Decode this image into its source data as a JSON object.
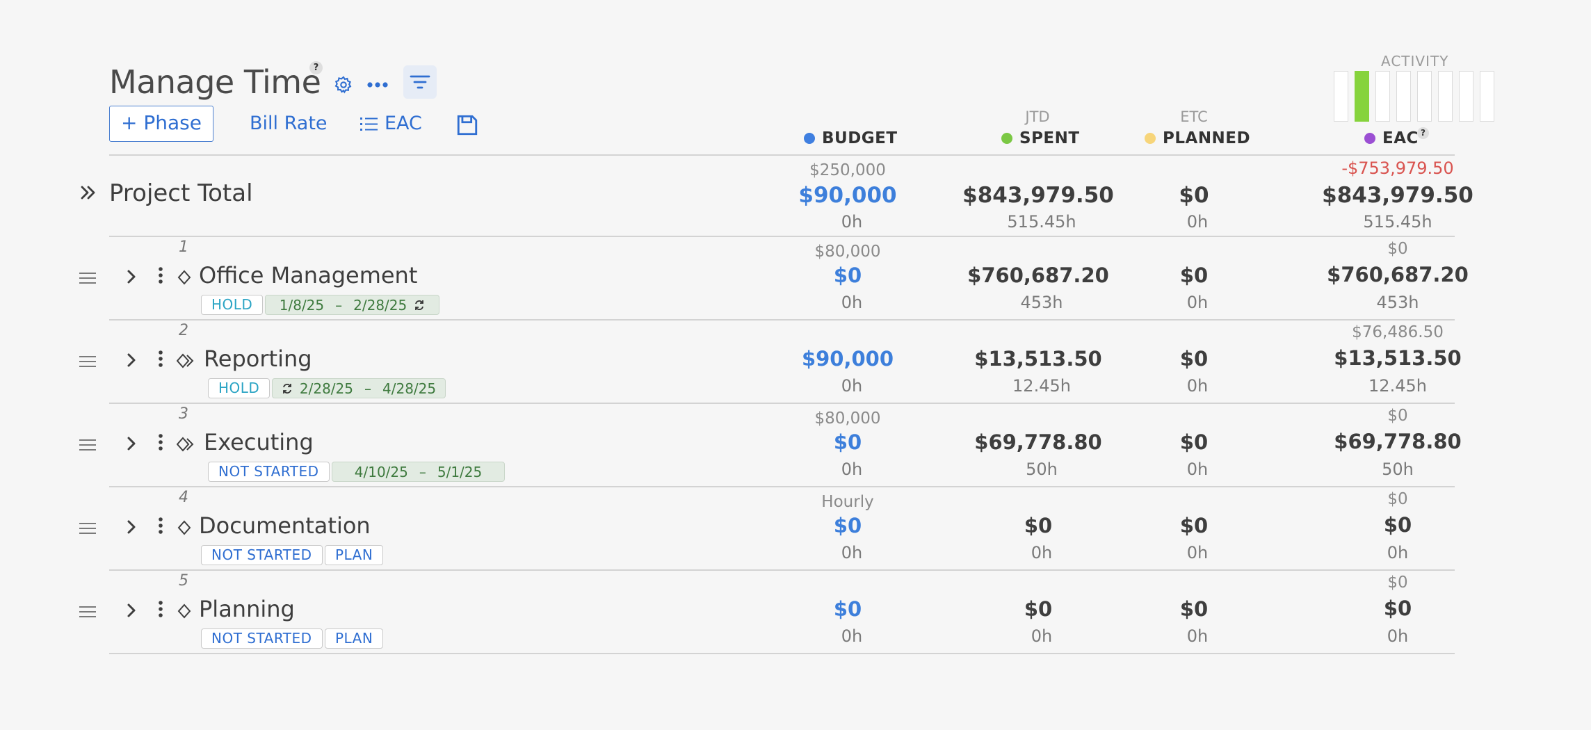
{
  "header": {
    "title": "Manage Time",
    "help_mark": "?",
    "add_phase_label": "+ Phase",
    "bill_rate_label": "Bill Rate",
    "eac_label": "EAC"
  },
  "columns": {
    "budget": {
      "label": "BUDGET",
      "color": "#3f7fe0"
    },
    "spent": {
      "label": "SPENT",
      "super": "JTD",
      "color": "#7bc844"
    },
    "planned": {
      "label": "PLANNED",
      "super": "ETC",
      "color": "#f7d57a"
    },
    "eac": {
      "label": "EAC",
      "help": "?",
      "color": "#9b4fd3"
    }
  },
  "activity": {
    "label": "ACTIVITY",
    "bars": [
      0,
      1,
      0,
      0,
      0,
      0,
      0,
      0
    ],
    "active_color": "#86d33c"
  },
  "total": {
    "name": "Project Total",
    "budget_top": "$250,000",
    "budget": "$90,000",
    "budget_hours": "0h",
    "spent": "$843,979.50",
    "spent_hours": "515.45h",
    "planned": "$0",
    "planned_hours": "0h",
    "eac_top": "-$753,979.50",
    "eac": "$843,979.50",
    "eac_hours": "515.45h"
  },
  "phases": [
    {
      "num": "1",
      "name": "Office Management",
      "status": "HOLD",
      "date_start": "1/8/25",
      "date_sep": "–",
      "date_end": "2/28/25",
      "budget_top": "$80,000",
      "budget": "$0",
      "budget_hours": "0h",
      "spent": "$760,687.20",
      "spent_hours": "453h",
      "planned": "$0",
      "planned_hours": "0h",
      "eac_top": "$0",
      "eac": "$760,687.20",
      "eac_hours": "453h"
    },
    {
      "num": "2",
      "name": "Reporting",
      "status": "HOLD",
      "date_start": "2/28/25",
      "date_sep": "–",
      "date_end": "4/28/25",
      "budget_top": "",
      "budget": "$90,000",
      "budget_hours": "0h",
      "spent": "$13,513.50",
      "spent_hours": "12.45h",
      "planned": "$0",
      "planned_hours": "0h",
      "eac_top": "$76,486.50",
      "eac": "$13,513.50",
      "eac_hours": "12.45h"
    },
    {
      "num": "3",
      "name": "Executing",
      "status": "NOT STARTED",
      "date_start": "4/10/25",
      "date_sep": "–",
      "date_end": "5/1/25",
      "budget_top": "$80,000",
      "budget": "$0",
      "budget_hours": "0h",
      "spent": "$69,778.80",
      "spent_hours": "50h",
      "planned": "$0",
      "planned_hours": "0h",
      "eac_top": "$0",
      "eac": "$69,778.80",
      "eac_hours": "50h"
    },
    {
      "num": "4",
      "name": "Documentation",
      "status": "NOT STARTED",
      "plan_label": "PLAN",
      "budget_top": "Hourly",
      "budget": "$0",
      "budget_hours": "0h",
      "spent": "$0",
      "spent_hours": "0h",
      "planned": "$0",
      "planned_hours": "0h",
      "eac_top": "$0",
      "eac": "$0",
      "eac_hours": "0h"
    },
    {
      "num": "5",
      "name": "Planning",
      "status": "NOT STARTED",
      "plan_label": "PLAN",
      "budget_top": "",
      "budget": "$0",
      "budget_hours": "0h",
      "spent": "$0",
      "spent_hours": "0h",
      "planned": "$0",
      "planned_hours": "0h",
      "eac_top": "$0",
      "eac": "$0",
      "eac_hours": "0h"
    }
  ]
}
